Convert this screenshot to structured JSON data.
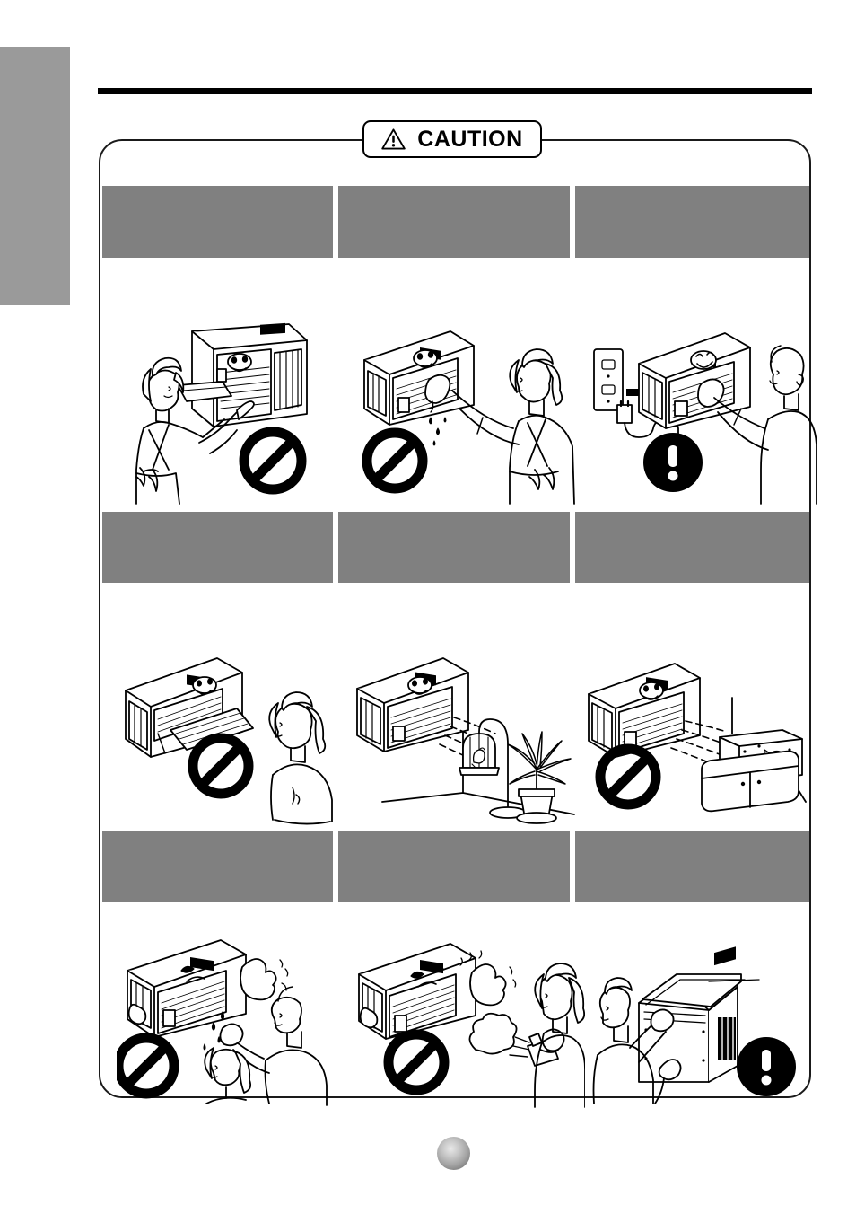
{
  "document": {
    "type": "air-conditioner-owners-manual-safety-page",
    "page_bullet_label": ""
  },
  "edge_tab": {
    "label": "",
    "color": "#9a9a9a"
  },
  "top_rule": {
    "color": "#000000"
  },
  "banner": {
    "label": "CAUTION",
    "icon": "warning-triangle-icon",
    "border_color": "#000000"
  },
  "colors": {
    "caption_gray": "#808080",
    "tab_gray": "#9a9a9a",
    "outline": "#000000",
    "panel_border": "#1a1a1a"
  },
  "cells": [
    {
      "id": "do-not-insert-hands",
      "caption_text": "",
      "symbol": "prohibition-icon",
      "symbol_label": "",
      "illustration": "woman-reaching-hand-into-air-conditioner-air-outlet"
    },
    {
      "id": "do-not-touch-with-wet-hands",
      "caption_text": "",
      "symbol": "prohibition-icon",
      "symbol_label": "",
      "illustration": "woman-touching-air-conditioner-with-dripping-wet-hand"
    },
    {
      "id": "unplug-before-cleaning",
      "caption_text": "",
      "symbol": "mandatory-action-icon",
      "symbol_label": "!",
      "illustration": "man-unplugging-power-cord-from-wall-outlet-before-cleaning-unit"
    },
    {
      "id": "do-not-direct-airflow-at-people",
      "caption_text": "",
      "symbol": "prohibition-icon",
      "symbol_label": "",
      "illustration": "air-conditioner-blowing-directly-at-seated-woman"
    },
    {
      "id": "do-not-direct-airflow-at-pets-and-plants",
      "caption_text": "",
      "symbol": "none",
      "symbol_label": "",
      "illustration": "air-conditioner-airflow-toward-hanging-birdcage-and-potted-plant"
    },
    {
      "id": "do-not-direct-airflow-at-aquarium",
      "caption_text": "",
      "symbol": "prohibition-icon",
      "symbol_label": "",
      "illustration": "air-conditioner-airflow-toward-aquarium-on-cabinet"
    },
    {
      "id": "do-not-splash-water-on-unit",
      "caption_text": "",
      "symbol": "prohibition-icon",
      "symbol_label": "",
      "illustration": "person-splashing-water-onto-air-conditioner-with-alarmed-face"
    },
    {
      "id": "do-not-spray-flammables-near-unit",
      "caption_text": "",
      "symbol": "prohibition-icon",
      "symbol_label": "",
      "illustration": "woman-spraying-aerosol-can-toward-air-conditioner"
    },
    {
      "id": "use-two-people-to-install-or-move",
      "caption_text": "",
      "symbol": "mandatory-action-icon",
      "symbol_label": "!",
      "illustration": "two-people-lifting-air-conditioner-chassis-together"
    }
  ],
  "layout": {
    "columns": 3,
    "rows": 3,
    "caption_rows_y": [
      205,
      568,
      922
    ],
    "figure_rows_y": [
      300,
      655,
      1012
    ]
  }
}
